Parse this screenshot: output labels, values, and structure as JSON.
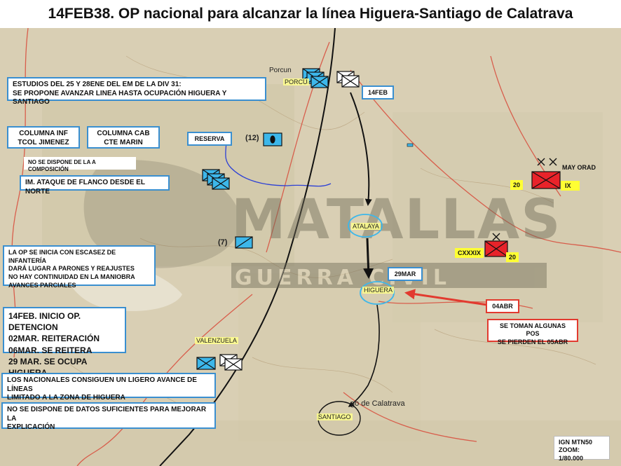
{
  "title": "14FEB38. OP nacional para alcanzar la línea Higuera-Santiago de Calatrava",
  "boxes": {
    "estudios_l1": "ESTUDIOS DEL 25 Y 28ENE DEL EM DE LA DIV 31:",
    "estudios_l2": "SE PROPONE AVANZAR LINEA HASTA OCUPACIÓN HIGUERA Y SANTIAGO",
    "col_inf_l1": "COLUMNA INF",
    "col_inf_l2": "TCOL JIMENEZ",
    "col_cab_l1": "COLUMNA CAB",
    "col_cab_l2": "CTE MARIN",
    "reserva": "RESERVA",
    "no_dispone_comp": "NO SE DISPONE DE LA A COMPOSICIÓN",
    "flanco": "IM. ATAQUE DE FLANCO DESDE EL NORTE",
    "op_inicia_l1": "LA OP SE INICIA CON ESCASEZ DE INFANTERÍA",
    "op_inicia_l2": "DARÁ LUGAR A PARONES Y REAJUSTES",
    "op_inicia_l3": "NO HAY CONTINUIDAD EN LA MANIOBRA",
    "op_inicia_l4": "AVANCES PARCIALES",
    "chrono_l1": "14FEB. INICIO OP. DETENCION",
    "chrono_l2": "02MAR.  REITERACIÓN",
    "chrono_l3": "06MAR. SE REITERA",
    "chrono_l4": "29 MAR. SE OCUPA HIGUERA",
    "nacionales_l1": "LOS NACIONALES CONSIGUEN UN LIGERO AVANCE DE LÍNEAS",
    "nacionales_l2": "LIMITADO A LA ZONA DE HIGUERA",
    "no_datos_l1": "NO SE DISPONE DE DATOS SUFICIENTES PARA MEJORAR LA",
    "no_datos_l2": "EXPLICACIÓN",
    "feb14": "14FEB",
    "mar29": "29MAR",
    "abr04": "04ABR",
    "toman_l1": "SE TOMAN ALGUNAS POS",
    "toman_l2": "SE PIERDEN EL 05ABR",
    "ign_l1": "IGN MTN50",
    "ign_l2": "ZOOM: 1/80.000"
  },
  "places": {
    "porcuna": "PORCU",
    "porcuna_map": "Porcun",
    "atalaya": "ATALAYA",
    "higuera": "HIGUERA",
    "santiago": "SANTIAGO",
    "valenzuela": "VALENZUELA",
    "calatrava_map": "go de Calatrava"
  },
  "units": {
    "n12": "(12)",
    "n7": "(7)"
  },
  "enemy": {
    "may_orad": "MAY ORAD",
    "n20a": "20",
    "ix": "IX",
    "cxxxix": "CXXXIX",
    "n20b": "20"
  },
  "watermark": {
    "line1": "MATALLAS",
    "line2": "GUERRA CIVIL"
  },
  "colors": {
    "friendly_fill": "#3db7ea",
    "friendly_box_border": "#3a8fd0",
    "enemy_fill": "#e8232a",
    "highlight": "#ffff33",
    "advance_arrow": "#111111",
    "counter_arrow": "#e23a2f",
    "river": "#2b3fd6",
    "front_line": "#111111"
  }
}
